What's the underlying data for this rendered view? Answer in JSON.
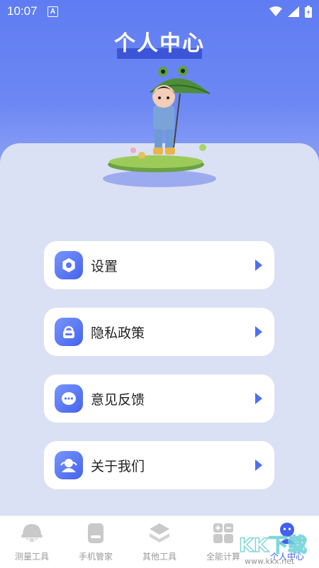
{
  "status_bar": {
    "time": "10:07",
    "notification_letter": "A"
  },
  "header": {
    "title": "个人中心"
  },
  "menu": [
    {
      "label": "设置",
      "icon": "gear-icon"
    },
    {
      "label": "隐私政策",
      "icon": "lock-icon"
    },
    {
      "label": "意见反馈",
      "icon": "chat-icon"
    },
    {
      "label": "关于我们",
      "icon": "about-icon"
    }
  ],
  "bottom_nav": [
    {
      "label": "测量工具",
      "icon": "helmet-icon"
    },
    {
      "label": "手机管家",
      "icon": "phone-icon"
    },
    {
      "label": "其他工具",
      "icon": "layers-icon"
    },
    {
      "label": "全能计算",
      "icon": "calculator-icon"
    },
    {
      "label": "个人中心",
      "icon": "person-icon",
      "active": true
    }
  ],
  "watermark": {
    "text": "KK下载",
    "url_text": "www.kkx.net"
  },
  "colors": {
    "accent": "#4460ee",
    "header": "#5f7cf2",
    "background": "#dbe1f4"
  }
}
